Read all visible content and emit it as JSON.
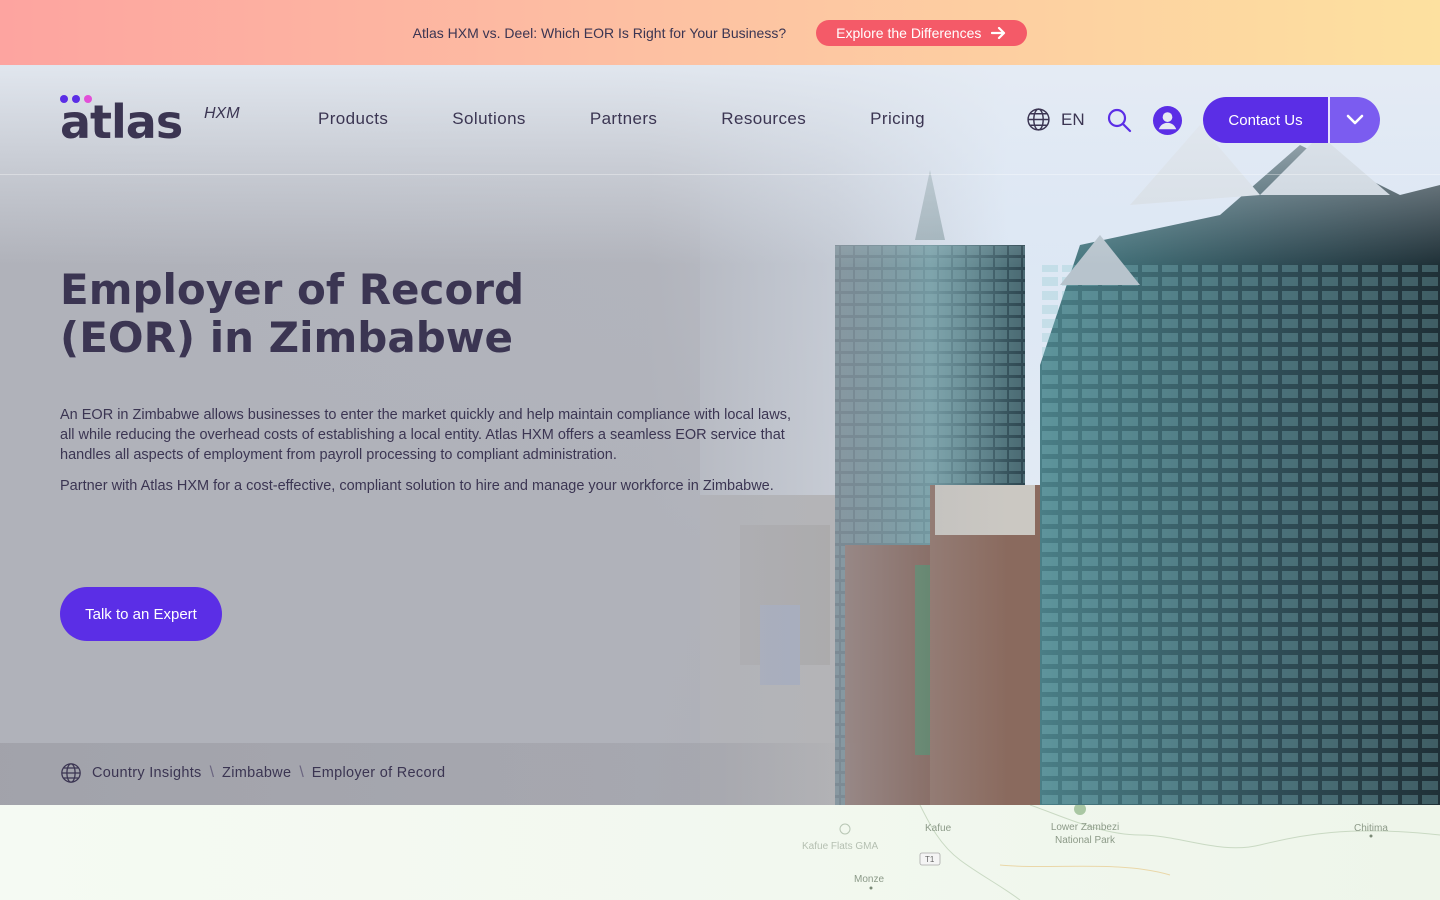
{
  "promo": {
    "text": "Atlas HXM vs. Deel: Which EOR Is Right for Your Business?",
    "button_label": "Explore the Differences"
  },
  "header": {
    "logo_word": "atlas",
    "logo_sub": "HXM",
    "nav": [
      "Products",
      "Solutions",
      "Partners",
      "Resources",
      "Pricing"
    ],
    "language": "EN",
    "contact_label": "Contact Us"
  },
  "hero": {
    "title_line1": "Employer of Record",
    "title_line2": "(EOR) in Zimbabwe",
    "paragraph1": "An EOR in Zimbabwe allows businesses to enter the market quickly and help maintain compliance with local laws, all while reducing the overhead costs of establishing a local entity. Atlas HXM offers a seamless EOR service that handles all aspects of employment from payroll processing to compliant administration.",
    "paragraph2": "Partner with Atlas HXM for a cost-effective, compliant solution to hire and manage your workforce in Zimbabwe.",
    "cta_label": "Talk to an Expert"
  },
  "breadcrumb": [
    "Country Insights",
    "Zimbabwe",
    "Employer of Record"
  ],
  "map": {
    "labels": [
      "Kafue",
      "Lower Zambezi National Park",
      "Chitima",
      "Kafue Flats GMA",
      "T1",
      "Monze"
    ]
  },
  "colors": {
    "brand_purple": "#5b2ee6",
    "promo_button": "#f45a68",
    "text_dark": "#3b3552"
  },
  "icons": {
    "promo": "arrow-right-icon",
    "language": "globe-icon",
    "search": "search-icon",
    "account": "user-icon",
    "dropdown": "chevron-down-icon",
    "breadcrumb": "globe-icon"
  }
}
